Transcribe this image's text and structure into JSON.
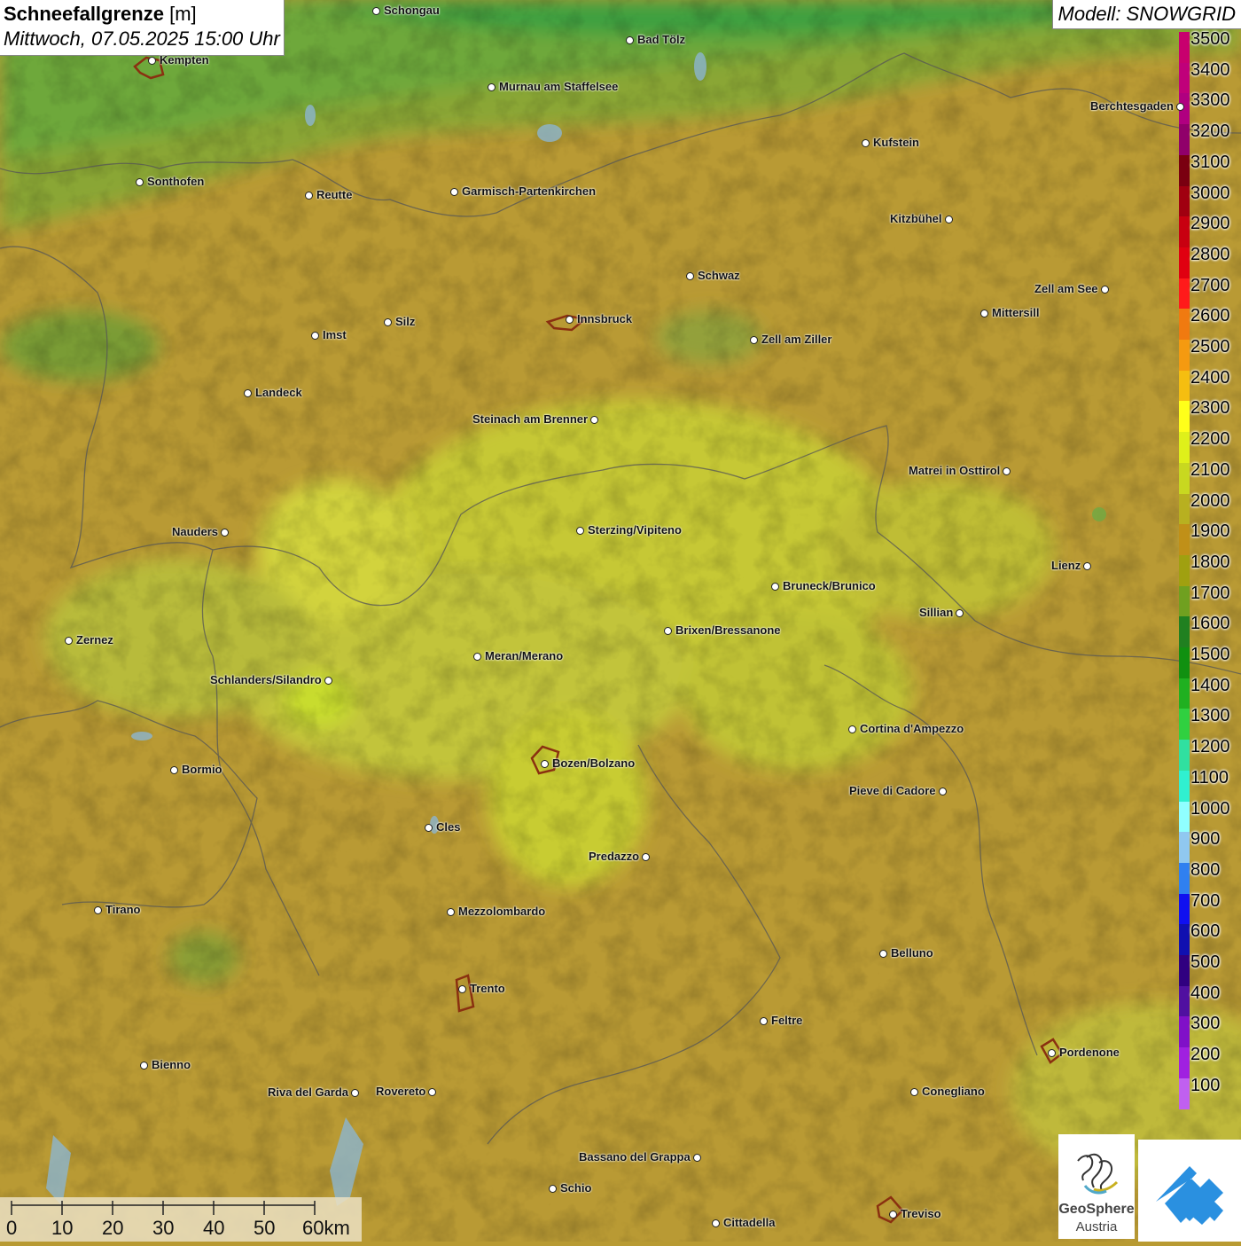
{
  "title": {
    "main": "Schneefallgrenze",
    "unit": "[m]",
    "datetime": "Mittwoch, 07.05.2025 15:00 Uhr"
  },
  "model": "Modell: SNOWGRID",
  "legend": {
    "labels": [
      "3500",
      "3400",
      "3300",
      "3200",
      "3100",
      "3000",
      "2900",
      "2800",
      "2700",
      "2600",
      "2500",
      "2400",
      "2300",
      "2200",
      "2100",
      "2000",
      "1900",
      "1800",
      "1700",
      "1600",
      "1500",
      "1400",
      "1300",
      "1200",
      "1100",
      "1000",
      "900",
      "800",
      "700",
      "600",
      "500",
      "400",
      "300",
      "200",
      "100"
    ],
    "colors": [
      "#c8006e",
      "#c0007a",
      "#b00080",
      "#90006a",
      "#7a0010",
      "#a00010",
      "#c80010",
      "#e00010",
      "#ff1a1a",
      "#f07a10",
      "#f59a10",
      "#f5be10",
      "#ffff1a",
      "#dff01a",
      "#c8d820",
      "#b8b020",
      "#c09018",
      "#a0a010",
      "#70a020",
      "#208020",
      "#109010",
      "#20b020",
      "#30d040",
      "#30e0a0",
      "#30f0d0",
      "#90ffff",
      "#90c8f0",
      "#3080f0",
      "#1010f0",
      "#1010b0",
      "#300080",
      "#5010a0",
      "#8010c8",
      "#a020e0",
      "#c060f0"
    ]
  },
  "cities": [
    {
      "name": "Schongau",
      "side": "right"
    },
    {
      "name": "Bad Tölz",
      "side": "right"
    },
    {
      "name": "Kempten",
      "side": "right"
    },
    {
      "name": "Murnau am Staffelsee",
      "side": "right"
    },
    {
      "name": "Berchtesgaden",
      "side": "left"
    },
    {
      "name": "Kufstein",
      "side": "right"
    },
    {
      "name": "Sonthofen",
      "side": "right"
    },
    {
      "name": "Reutte",
      "side": "right"
    },
    {
      "name": "Garmisch-Partenkirchen",
      "side": "right"
    },
    {
      "name": "Kitzbühel",
      "side": "left"
    },
    {
      "name": "Schwaz",
      "side": "right"
    },
    {
      "name": "Zell am See",
      "side": "left"
    },
    {
      "name": "Innsbruck",
      "side": "right"
    },
    {
      "name": "Mittersill",
      "side": "right"
    },
    {
      "name": "Imst",
      "side": "right"
    },
    {
      "name": "Silz",
      "side": "right"
    },
    {
      "name": "Zell am Ziller",
      "side": "right"
    },
    {
      "name": "Landeck",
      "side": "right"
    },
    {
      "name": "Steinach am Brenner",
      "side": "left"
    },
    {
      "name": "Matrei in Osttirol",
      "side": "left"
    },
    {
      "name": "Nauders",
      "side": "left"
    },
    {
      "name": "Sterzing/Vipiteno",
      "side": "right"
    },
    {
      "name": "Lienz",
      "side": "left"
    },
    {
      "name": "Bruneck/Brunico",
      "side": "right"
    },
    {
      "name": "Sillian",
      "side": "left"
    },
    {
      "name": "Zernez",
      "side": "right"
    },
    {
      "name": "Brixen/Bressanone",
      "side": "right"
    },
    {
      "name": "Meran/Merano",
      "side": "right"
    },
    {
      "name": "Schlanders/Silandro",
      "side": "left"
    },
    {
      "name": "Cortina d'Ampezzo",
      "side": "right"
    },
    {
      "name": "Bozen/Bolzano",
      "side": "right"
    },
    {
      "name": "Bormio",
      "side": "right"
    },
    {
      "name": "Pieve di Cadore",
      "side": "left"
    },
    {
      "name": "Cles",
      "side": "right"
    },
    {
      "name": "Predazzo",
      "side": "left"
    },
    {
      "name": "Tirano",
      "side": "right"
    },
    {
      "name": "Mezzolombardo",
      "side": "right"
    },
    {
      "name": "Belluno",
      "side": "right"
    },
    {
      "name": "Trento",
      "side": "right"
    },
    {
      "name": "Feltre",
      "side": "right"
    },
    {
      "name": "Pordenone",
      "side": "right"
    },
    {
      "name": "Bienno",
      "side": "right"
    },
    {
      "name": "Riva del Garda",
      "side": "left"
    },
    {
      "name": "Rovereto",
      "side": "left"
    },
    {
      "name": "Conegliano",
      "side": "right"
    },
    {
      "name": "Bassano del Grappa",
      "side": "left"
    },
    {
      "name": "Schio",
      "side": "right"
    },
    {
      "name": "Treviso",
      "side": "right"
    },
    {
      "name": "Cittadella",
      "side": "right"
    }
  ],
  "scale": {
    "labels": [
      "0",
      "10",
      "20",
      "30",
      "40",
      "50",
      "60km"
    ]
  },
  "logo": {
    "name_line1": "GeoSphere",
    "name_line2": "Austria"
  }
}
